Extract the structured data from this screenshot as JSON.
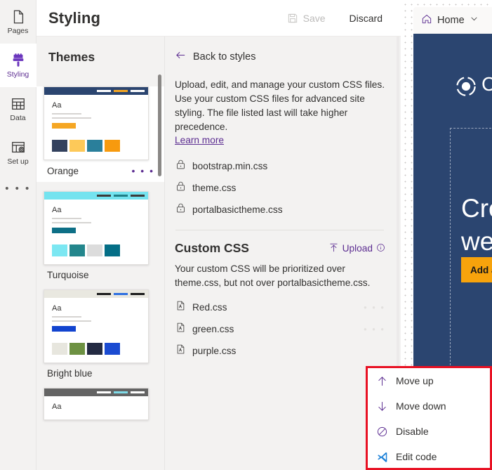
{
  "rail": {
    "items": [
      {
        "label": "Pages",
        "icon": "page-icon",
        "active": false
      },
      {
        "label": "Styling",
        "icon": "paint-brush-icon",
        "active": true
      },
      {
        "label": "Data",
        "icon": "table-icon",
        "active": false
      },
      {
        "label": "Set up",
        "icon": "setup-gear-icon",
        "active": false
      }
    ],
    "more_label": "• • •"
  },
  "header": {
    "title": "Styling",
    "save_label": "Save",
    "discard_label": "Discard"
  },
  "themes": {
    "heading": "Themes",
    "cards": [
      {
        "name": "Orange",
        "selected": true,
        "sample_text": "Aa",
        "bar_color": "#2b4570",
        "bar_links": [
          "#ffffff",
          "#f5a623",
          "#ffffff"
        ],
        "button_color": "#f5a623",
        "swatches": [
          "#33415e",
          "#fdc959",
          "#2a7f9b",
          "#f79a0e"
        ],
        "menu_label": "• • •"
      },
      {
        "name": "Turquoise",
        "selected": false,
        "sample_text": "Aa",
        "bar_color": "#74e3ef",
        "bar_links": [
          "#3b3a39",
          "#1f7d85",
          "#3b3a39"
        ],
        "button_color": "#0d6f86",
        "swatches": [
          "#7ce7f2",
          "#23868c",
          "#dcdcdc",
          "#046e86"
        ],
        "menu_label": "• • •"
      },
      {
        "name": "Bright blue",
        "selected": false,
        "sample_text": "Aa",
        "bar_color": "#e9e8e0",
        "bar_links": [
          "#1b1b1b",
          "#2d6fe0",
          "#1b1b1b"
        ],
        "button_color": "#1244cf",
        "swatches": [
          "#e7e6de",
          "#6d9142",
          "#232a42",
          "#1b4bd1"
        ],
        "menu_label": "• • •"
      },
      {
        "name": "",
        "selected": false,
        "sample_text": "Aa",
        "bar_color": "#646464",
        "bar_links": [
          "#ffffff",
          "#7fdbe8",
          "#ffffff"
        ],
        "button_color": "#646464",
        "swatches": [],
        "menu_label": ""
      }
    ]
  },
  "detail": {
    "back_label": "Back to styles",
    "description": "Upload, edit, and manage your custom CSS files. Use your custom CSS files for advanced site styling. The file listed last will take higher precedence.",
    "learn_more_label": "Learn more",
    "locked_files": [
      {
        "name": "bootstrap.min.css",
        "icon": "lock-icon"
      },
      {
        "name": "theme.css",
        "icon": "lock-icon"
      },
      {
        "name": "portalbasictheme.css",
        "icon": "lock-icon"
      }
    ],
    "custom_css": {
      "title": "Custom CSS",
      "upload_label": "Upload",
      "upload_icon": "upload-arrow-icon",
      "info_icon": "info-circle-icon",
      "description": "Your custom CSS will be prioritized over theme.css, but not over portalbasictheme.css.",
      "files": [
        {
          "name": "Red.css",
          "icon": "css-file-icon",
          "menu_label": "• • •"
        },
        {
          "name": "green.css",
          "icon": "css-file-icon",
          "menu_label": "• • •"
        },
        {
          "name": "purple.css",
          "icon": "css-file-icon",
          "menu_label": ""
        }
      ]
    }
  },
  "preview": {
    "home_label": "Home",
    "home_icon": "home-icon",
    "chevron_icon": "chevron-down-icon",
    "brand_text": "C",
    "logo_icon": "circle-logo-icon",
    "headline": "Cre\nwelc",
    "cta_label": "Add a",
    "banner_color": "#2b4570",
    "cta_color": "#f7a30c"
  },
  "context_menu": {
    "highlight_color": "#e81123",
    "items": [
      {
        "label": "Move up",
        "icon": "arrow-up-icon"
      },
      {
        "label": "Move down",
        "icon": "arrow-down-icon"
      },
      {
        "label": "Disable",
        "icon": "block-circle-icon"
      },
      {
        "label": "Edit code",
        "icon": "vscode-icon"
      }
    ]
  }
}
